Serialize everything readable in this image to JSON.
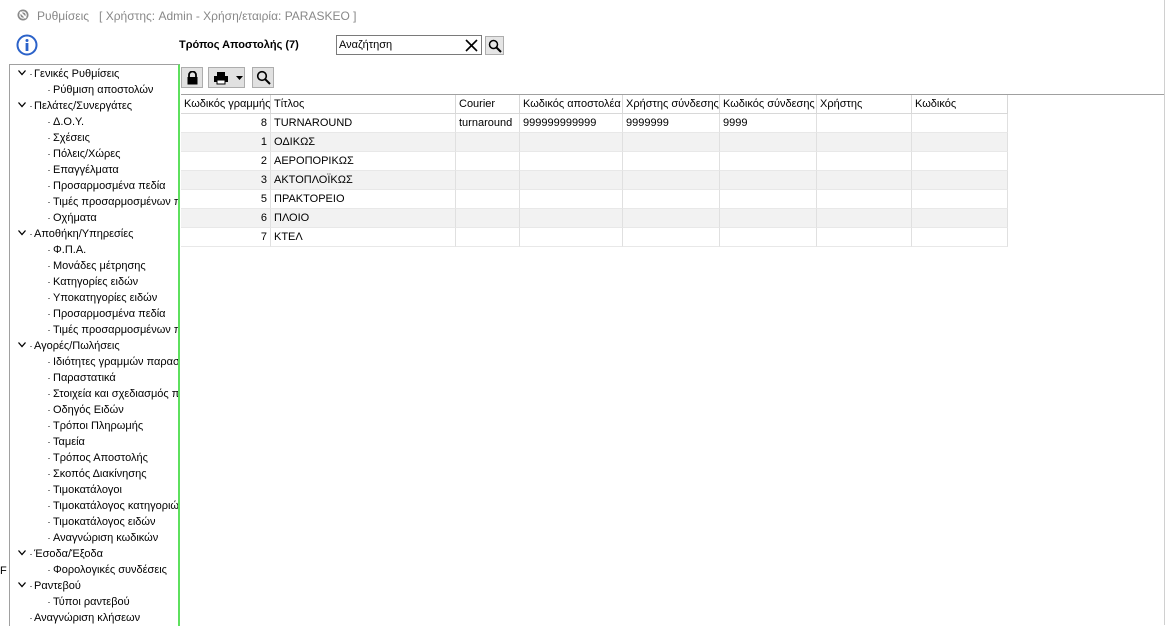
{
  "window": {
    "app_name": "Ρυθμίσεις",
    "user_info": "[ Χρήστης: Admin - Χρήση/εταιρία: PARASKEO ]"
  },
  "header": {
    "section_title": "Τρόπος Αποστολής (7)",
    "search_value": "Αναζήτηση"
  },
  "tree": [
    {
      "label": "Γενικές Ρυθμίσεις",
      "level": 0,
      "expanded": true
    },
    {
      "label": "Ρύθμιση αποστολών",
      "level": 1
    },
    {
      "label": "Πελάτες/Συνεργάτες",
      "level": 0,
      "expanded": true
    },
    {
      "label": "Δ.Ο.Υ.",
      "level": 1
    },
    {
      "label": "Σχέσεις",
      "level": 1
    },
    {
      "label": "Πόλεις/Χώρες",
      "level": 1
    },
    {
      "label": "Επαγγέλματα",
      "level": 1
    },
    {
      "label": "Προσαρμοσμένα πεδία",
      "level": 1
    },
    {
      "label": "Τιμές προσαρμοσμένων π",
      "level": 1
    },
    {
      "label": "Οχήματα",
      "level": 1
    },
    {
      "label": "Αποθήκη/Υπηρεσίες",
      "level": 0,
      "expanded": true
    },
    {
      "label": "Φ.Π.Α.",
      "level": 1
    },
    {
      "label": "Μονάδες μέτρησης",
      "level": 1
    },
    {
      "label": "Κατηγορίες ειδών",
      "level": 1
    },
    {
      "label": "Υποκατηγορίες ειδών",
      "level": 1
    },
    {
      "label": "Προσαρμοσμένα πεδία",
      "level": 1
    },
    {
      "label": "Τιμές προσαρμοσμένων π",
      "level": 1
    },
    {
      "label": "Αγορές/Πωλήσεις",
      "level": 0,
      "expanded": true
    },
    {
      "label": "Ιδιότητες γραμμών παρασ",
      "level": 1
    },
    {
      "label": "Παραστατικά",
      "level": 1
    },
    {
      "label": "Στοιχεία και σχεδιασμός π",
      "level": 1
    },
    {
      "label": "Οδηγός Ειδών",
      "level": 1
    },
    {
      "label": "Τρόποι Πληρωμής",
      "level": 1
    },
    {
      "label": "Ταμεία",
      "level": 1
    },
    {
      "label": "Τρόπος Αποστολής",
      "level": 1
    },
    {
      "label": "Σκοπός Διακίνησης",
      "level": 1
    },
    {
      "label": "Τιμοκατάλογοι",
      "level": 1
    },
    {
      "label": "Τιμοκατάλογος κατηγοριώ",
      "level": 1
    },
    {
      "label": "Τιμοκατάλογος ειδών",
      "level": 1
    },
    {
      "label": "Αναγνώριση κωδικών",
      "level": 1
    },
    {
      "label": "Έσοδα/Έξοδα",
      "level": 0,
      "expanded": true
    },
    {
      "label": "Φορολογικές συνδέσεις",
      "level": 1
    },
    {
      "label": "Ραντεβού",
      "level": 0,
      "expanded": true
    },
    {
      "label": "Τύποι ραντεβού",
      "level": 1
    },
    {
      "label": "Αναγνώριση κλήσεων",
      "level": 0
    }
  ],
  "grid": {
    "columns": [
      "Κωδικός γραμμής",
      "Τίτλος",
      "Courier",
      "Κωδικός αποστολέα",
      "Χρήστης σύνδεσης",
      "Κωδικός σύνδεσης",
      "Χρήστης",
      "Κωδικός"
    ],
    "rows": [
      [
        "8",
        "TURNAROUND",
        "turnaround",
        "999999999999",
        "9999999",
        "9999",
        "",
        ""
      ],
      [
        "1",
        "ΟΔΙΚΩΣ",
        "",
        "",
        "",
        "",
        "",
        ""
      ],
      [
        "2",
        "ΑΕΡΟΠΟΡΙΚΩΣ",
        "",
        "",
        "",
        "",
        "",
        ""
      ],
      [
        "3",
        "ΑΚΤΟΠΛΟΪΚΩΣ",
        "",
        "",
        "",
        "",
        "",
        ""
      ],
      [
        "5",
        "ΠΡΑΚΤΟΡΕΙΟ",
        "",
        "",
        "",
        "",
        "",
        ""
      ],
      [
        "6",
        "ΠΛΟΙΟ",
        "",
        "",
        "",
        "",
        "",
        ""
      ],
      [
        "7",
        "ΚΤΕΛ",
        "",
        "",
        "",
        "",
        "",
        ""
      ]
    ]
  },
  "icons": {
    "app": "settings-icon",
    "info": "info-icon",
    "clear": "close-icon",
    "search": "search-icon",
    "lock": "lock-icon",
    "print": "printer-icon",
    "dropdown": "chevron-down-icon"
  },
  "colors": {
    "accent": "#2b62c9",
    "panel_border": "#5ee05e",
    "title_text": "#888888"
  },
  "edge_text": "F"
}
